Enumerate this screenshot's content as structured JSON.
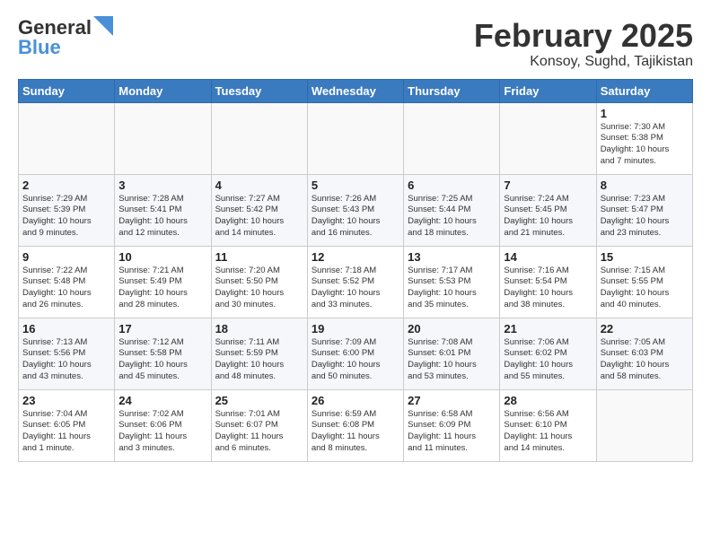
{
  "header": {
    "logo_general": "General",
    "logo_blue": "Blue",
    "month_title": "February 2025",
    "location": "Konsoy, Sughd, Tajikistan"
  },
  "weekdays": [
    "Sunday",
    "Monday",
    "Tuesday",
    "Wednesday",
    "Thursday",
    "Friday",
    "Saturday"
  ],
  "weeks": [
    [
      {
        "day": "",
        "info": ""
      },
      {
        "day": "",
        "info": ""
      },
      {
        "day": "",
        "info": ""
      },
      {
        "day": "",
        "info": ""
      },
      {
        "day": "",
        "info": ""
      },
      {
        "day": "",
        "info": ""
      },
      {
        "day": "1",
        "info": "Sunrise: 7:30 AM\nSunset: 5:38 PM\nDaylight: 10 hours\nand 7 minutes."
      }
    ],
    [
      {
        "day": "2",
        "info": "Sunrise: 7:29 AM\nSunset: 5:39 PM\nDaylight: 10 hours\nand 9 minutes."
      },
      {
        "day": "3",
        "info": "Sunrise: 7:28 AM\nSunset: 5:41 PM\nDaylight: 10 hours\nand 12 minutes."
      },
      {
        "day": "4",
        "info": "Sunrise: 7:27 AM\nSunset: 5:42 PM\nDaylight: 10 hours\nand 14 minutes."
      },
      {
        "day": "5",
        "info": "Sunrise: 7:26 AM\nSunset: 5:43 PM\nDaylight: 10 hours\nand 16 minutes."
      },
      {
        "day": "6",
        "info": "Sunrise: 7:25 AM\nSunset: 5:44 PM\nDaylight: 10 hours\nand 18 minutes."
      },
      {
        "day": "7",
        "info": "Sunrise: 7:24 AM\nSunset: 5:45 PM\nDaylight: 10 hours\nand 21 minutes."
      },
      {
        "day": "8",
        "info": "Sunrise: 7:23 AM\nSunset: 5:47 PM\nDaylight: 10 hours\nand 23 minutes."
      }
    ],
    [
      {
        "day": "9",
        "info": "Sunrise: 7:22 AM\nSunset: 5:48 PM\nDaylight: 10 hours\nand 26 minutes."
      },
      {
        "day": "10",
        "info": "Sunrise: 7:21 AM\nSunset: 5:49 PM\nDaylight: 10 hours\nand 28 minutes."
      },
      {
        "day": "11",
        "info": "Sunrise: 7:20 AM\nSunset: 5:50 PM\nDaylight: 10 hours\nand 30 minutes."
      },
      {
        "day": "12",
        "info": "Sunrise: 7:18 AM\nSunset: 5:52 PM\nDaylight: 10 hours\nand 33 minutes."
      },
      {
        "day": "13",
        "info": "Sunrise: 7:17 AM\nSunset: 5:53 PM\nDaylight: 10 hours\nand 35 minutes."
      },
      {
        "day": "14",
        "info": "Sunrise: 7:16 AM\nSunset: 5:54 PM\nDaylight: 10 hours\nand 38 minutes."
      },
      {
        "day": "15",
        "info": "Sunrise: 7:15 AM\nSunset: 5:55 PM\nDaylight: 10 hours\nand 40 minutes."
      }
    ],
    [
      {
        "day": "16",
        "info": "Sunrise: 7:13 AM\nSunset: 5:56 PM\nDaylight: 10 hours\nand 43 minutes."
      },
      {
        "day": "17",
        "info": "Sunrise: 7:12 AM\nSunset: 5:58 PM\nDaylight: 10 hours\nand 45 minutes."
      },
      {
        "day": "18",
        "info": "Sunrise: 7:11 AM\nSunset: 5:59 PM\nDaylight: 10 hours\nand 48 minutes."
      },
      {
        "day": "19",
        "info": "Sunrise: 7:09 AM\nSunset: 6:00 PM\nDaylight: 10 hours\nand 50 minutes."
      },
      {
        "day": "20",
        "info": "Sunrise: 7:08 AM\nSunset: 6:01 PM\nDaylight: 10 hours\nand 53 minutes."
      },
      {
        "day": "21",
        "info": "Sunrise: 7:06 AM\nSunset: 6:02 PM\nDaylight: 10 hours\nand 55 minutes."
      },
      {
        "day": "22",
        "info": "Sunrise: 7:05 AM\nSunset: 6:03 PM\nDaylight: 10 hours\nand 58 minutes."
      }
    ],
    [
      {
        "day": "23",
        "info": "Sunrise: 7:04 AM\nSunset: 6:05 PM\nDaylight: 11 hours\nand 1 minute."
      },
      {
        "day": "24",
        "info": "Sunrise: 7:02 AM\nSunset: 6:06 PM\nDaylight: 11 hours\nand 3 minutes."
      },
      {
        "day": "25",
        "info": "Sunrise: 7:01 AM\nSunset: 6:07 PM\nDaylight: 11 hours\nand 6 minutes."
      },
      {
        "day": "26",
        "info": "Sunrise: 6:59 AM\nSunset: 6:08 PM\nDaylight: 11 hours\nand 8 minutes."
      },
      {
        "day": "27",
        "info": "Sunrise: 6:58 AM\nSunset: 6:09 PM\nDaylight: 11 hours\nand 11 minutes."
      },
      {
        "day": "28",
        "info": "Sunrise: 6:56 AM\nSunset: 6:10 PM\nDaylight: 11 hours\nand 14 minutes."
      },
      {
        "day": "",
        "info": ""
      }
    ]
  ]
}
